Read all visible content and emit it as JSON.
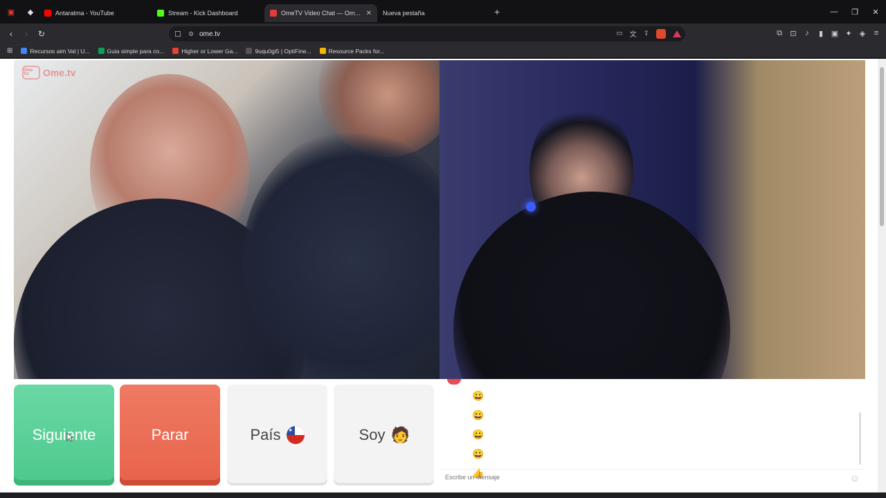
{
  "tabs": [
    {
      "label": "Antaratma - YouTube",
      "color": "#ff0000",
      "active": false
    },
    {
      "label": "Stream - Kick Dashboard",
      "color": "#53fc18",
      "active": false
    },
    {
      "label": "OmeTV Video Chat — Omegl",
      "color": "#e33b3b",
      "active": true
    },
    {
      "label": "Nueva pestaña",
      "color": "",
      "active": false
    }
  ],
  "address_bar": {
    "url": "ome.tv"
  },
  "bookmarks": [
    {
      "label": "Recursos aim Val | U...",
      "color": "#4285f4"
    },
    {
      "label": "Guia simple para co...",
      "color": "#0f9d58"
    },
    {
      "label": "Higher or Lower Ga...",
      "color": "#e94235"
    },
    {
      "label": "9uqu0gi5 | OptiFine...",
      "color": "#555555"
    },
    {
      "label": "Resource Packs for...",
      "color": "#f4b400"
    }
  ],
  "site": {
    "logo_text": "Ome.tv",
    "logo_badge": "Ome TV"
  },
  "controls": {
    "next_label": "Siguiente",
    "stop_label": "Parar",
    "country_label": "País",
    "gender_label": "Soy"
  },
  "chat": {
    "messages": [
      "😀",
      "😀",
      "😀",
      "😀",
      "👍"
    ],
    "placeholder": "Escribe un mensaje"
  },
  "colors": {
    "next": "#5fd49b",
    "stop": "#ec6e55",
    "accent": "#e84c56"
  }
}
